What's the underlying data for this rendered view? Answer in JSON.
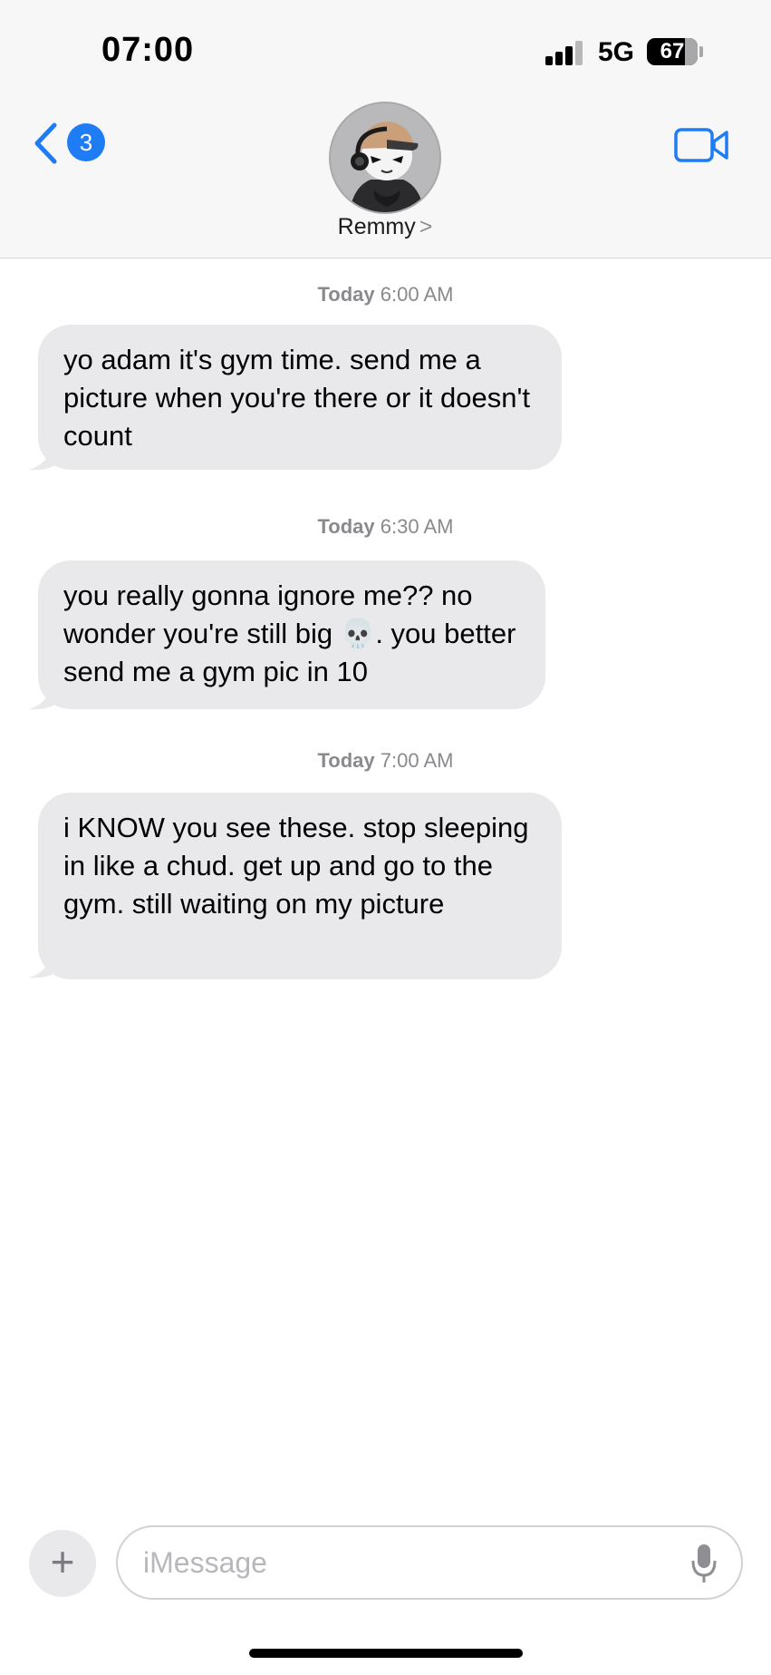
{
  "status_bar": {
    "time": "07:00",
    "network": "5G",
    "battery": "67"
  },
  "nav": {
    "back_badge": "3",
    "contact_name": "Remmy",
    "contact_chevron": ">"
  },
  "messages": [
    {
      "timestamp_day": "Today",
      "timestamp_time": "6:00 AM",
      "text": "yo adam it's gym time. send me a picture when you're there or it doesn't count"
    },
    {
      "timestamp_day": "Today",
      "timestamp_time": "6:30 AM",
      "text": "you really gonna ignore me?? no wonder you're still big 💀. you better send me a gym pic in 10"
    },
    {
      "timestamp_day": "Today",
      "timestamp_time": "7:00 AM",
      "text": "i KNOW you see these. stop sleeping in like a chud. get up and go to the gym. still waiting on my picture"
    }
  ],
  "composer": {
    "plus": "+",
    "placeholder": "iMessage"
  },
  "icons": {
    "back": "chevron-left-icon",
    "video": "video-camera-icon",
    "mic": "microphone-icon",
    "add": "plus-icon"
  },
  "colors": {
    "accent": "#1e7cf5",
    "bubble": "#e9e9eb",
    "timestamp": "#8a8a8e"
  }
}
